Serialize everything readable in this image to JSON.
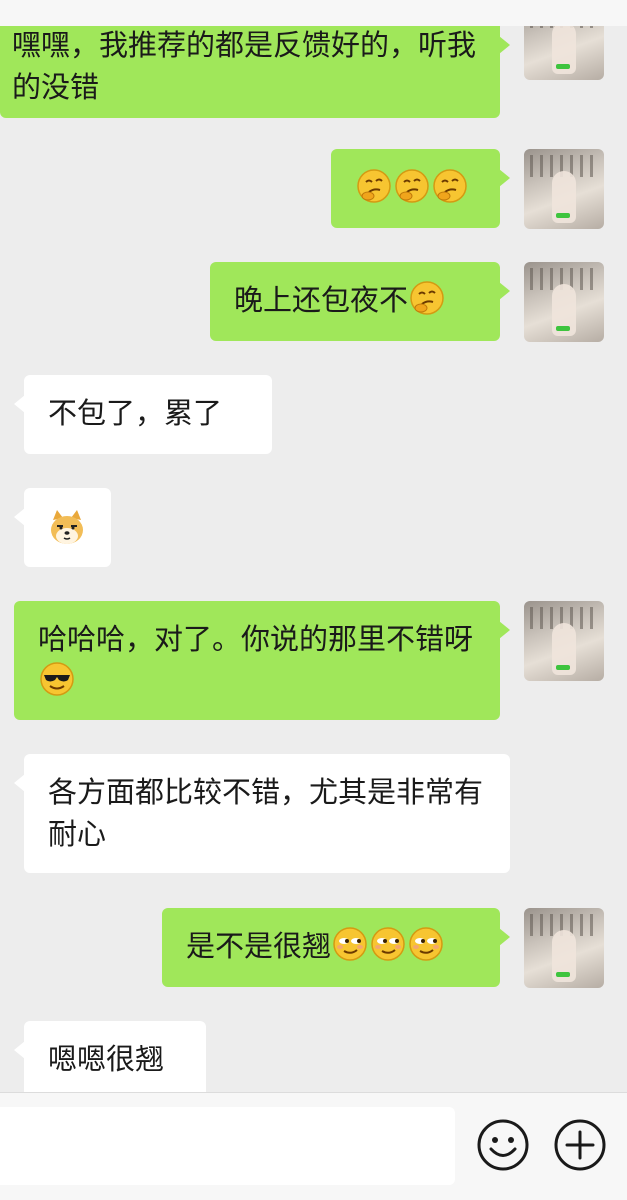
{
  "messages": [
    {
      "side": "me",
      "text": "嘿嘿，我推荐的都是反馈好的，听我的没错",
      "emoji": []
    },
    {
      "side": "me",
      "text": "",
      "emoji": [
        "thinking-face",
        "thinking-face",
        "thinking-face"
      ]
    },
    {
      "side": "me",
      "text": "晚上还包夜不",
      "emoji": [
        "thinking-face"
      ]
    },
    {
      "side": "other",
      "text": "不包了，累了",
      "emoji": []
    },
    {
      "side": "other",
      "text": "",
      "emoji": [
        "doge-face"
      ]
    },
    {
      "side": "me",
      "text": "哈哈哈，对了。你说的那里不错呀",
      "emoji": [
        "sunglasses-face"
      ]
    },
    {
      "side": "other",
      "text": "各方面都比较不错，尤其是非常有耐心",
      "emoji": []
    },
    {
      "side": "me",
      "text": "是不是很翘",
      "emoji": [
        "smirk-face",
        "smirk-face",
        "smirk-face"
      ]
    },
    {
      "side": "other",
      "text": "嗯嗯很翘",
      "emoji": []
    }
  ],
  "input": {
    "value": "",
    "emoji_icon": "smiley-icon",
    "add_icon": "plus-circle-icon"
  },
  "colors": {
    "my_bubble": "#a0e75a",
    "their_bubble": "#ffffff",
    "background": "#ededed"
  }
}
